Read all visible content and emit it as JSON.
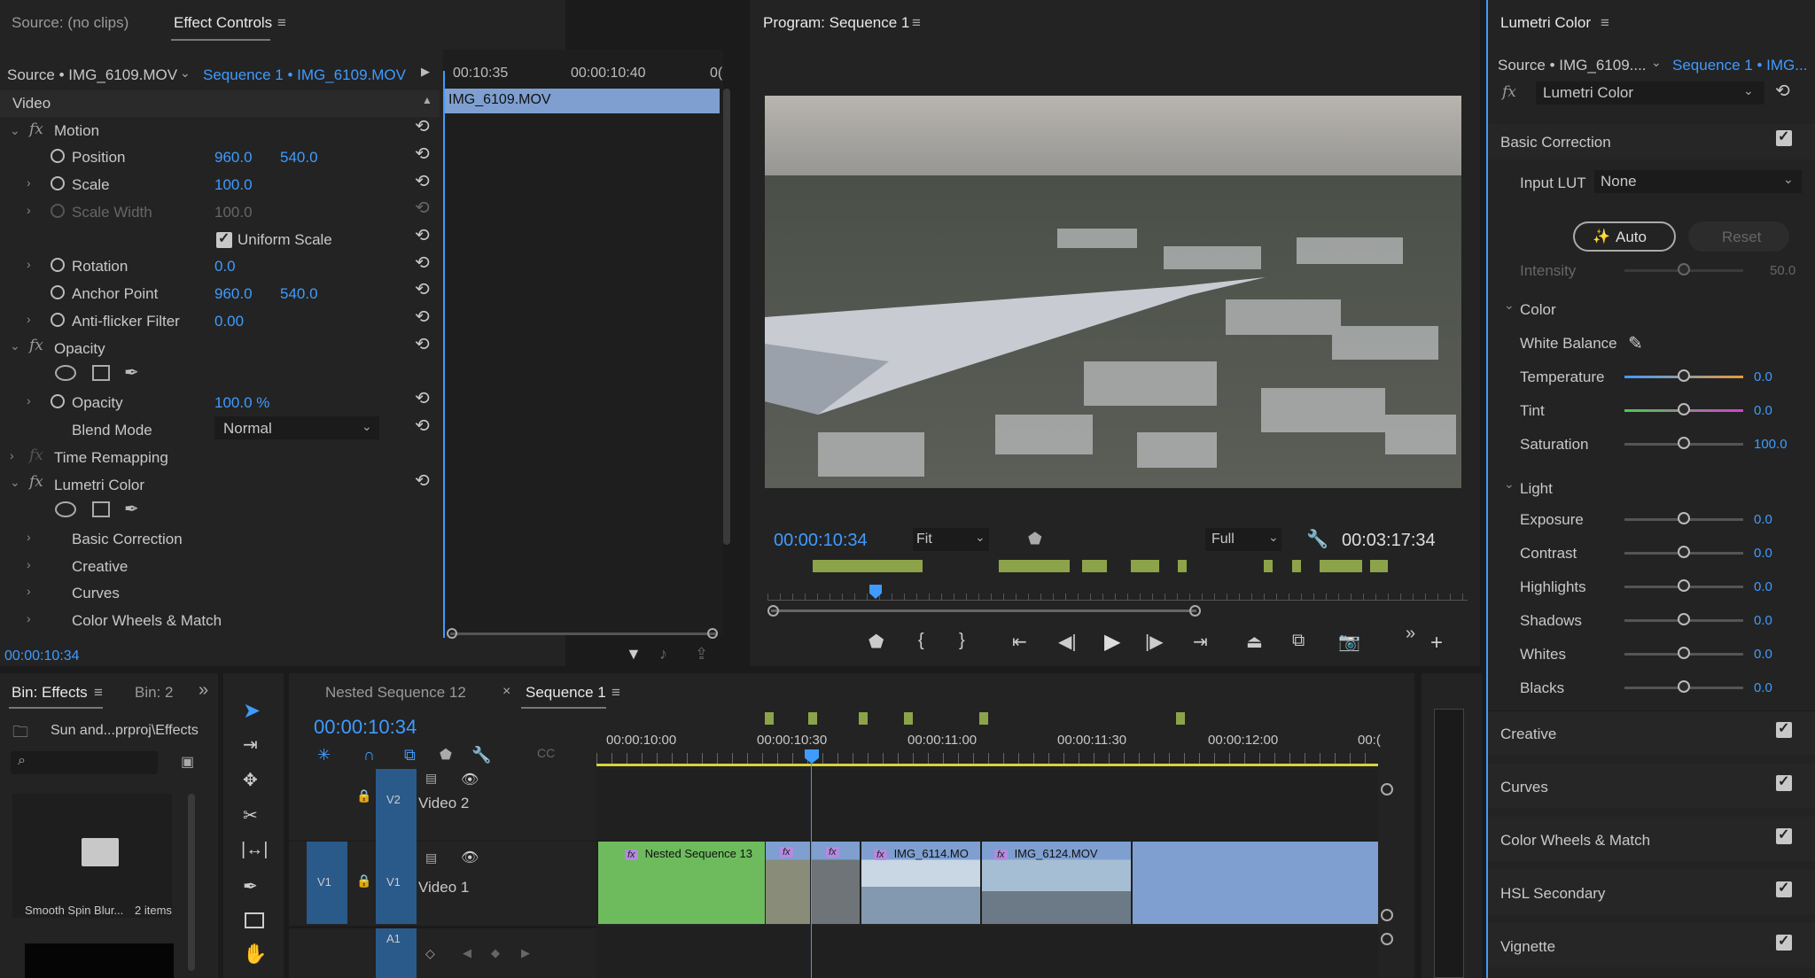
{
  "effect_controls": {
    "tabs": [
      "Source: (no clips)",
      "Effect Controls"
    ],
    "source_label": "Source • IMG_6109.MOV",
    "sequence_label": "Sequence 1 • IMG_6109.MOV",
    "time_ruler": [
      "00:10:35",
      "00:00:10:40",
      "0("
    ],
    "clip_name": "IMG_6109.MOV",
    "section_video": "Video",
    "motion": "Motion",
    "position_label": "Position",
    "position_x": "960.0",
    "position_y": "540.0",
    "scale_label": "Scale",
    "scale_val": "100.0",
    "scale_width_label": "Scale Width",
    "scale_width_val": "100.0",
    "uniform_scale": "Uniform Scale",
    "rotation_label": "Rotation",
    "rotation_val": "0.0",
    "anchor_label": "Anchor Point",
    "anchor_x": "960.0",
    "anchor_y": "540.0",
    "antiflicker_label": "Anti-flicker Filter",
    "antiflicker_val": "0.00",
    "opacity_group": "Opacity",
    "opacity_label": "Opacity",
    "opacity_val": "100.0 %",
    "blend_label": "Blend Mode",
    "blend_val": "Normal",
    "time_remap": "Time Remapping",
    "lumetri": "Lumetri Color",
    "basic": "Basic Correction",
    "creative": "Creative",
    "curves": "Curves",
    "wheels": "Color Wheels & Match",
    "timecode": "00:00:10:34"
  },
  "program": {
    "title": "Program: Sequence 1",
    "timecode": "00:00:10:34",
    "fit": "Fit",
    "quality": "Full",
    "duration": "00:03:17:34"
  },
  "lumetri": {
    "title": "Lumetri Color",
    "source": "Source • IMG_6109....",
    "sequence": "Sequence 1 • IMG...",
    "effect": "Lumetri Color",
    "basic": "Basic Correction",
    "input_lut_label": "Input LUT",
    "input_lut_val": "None",
    "auto": "Auto",
    "reset": "Reset",
    "intensity_label": "Intensity",
    "intensity_val": "50.0",
    "color": "Color",
    "wb": "White Balance",
    "temp_label": "Temperature",
    "temp_val": "0.0",
    "tint_label": "Tint",
    "tint_val": "0.0",
    "sat_label": "Saturation",
    "sat_val": "100.0",
    "light": "Light",
    "exposure_label": "Exposure",
    "exposure_val": "0.0",
    "contrast_label": "Contrast",
    "contrast_val": "0.0",
    "highlights_label": "Highlights",
    "highlights_val": "0.0",
    "shadows_label": "Shadows",
    "shadows_val": "0.0",
    "whites_label": "Whites",
    "whites_val": "0.0",
    "blacks_label": "Blacks",
    "blacks_val": "0.0",
    "sections": [
      "Creative",
      "Curves",
      "Color Wheels & Match",
      "HSL Secondary",
      "Vignette"
    ]
  },
  "bin": {
    "tab": "Bin: Effects",
    "tab2": "Bin: 2",
    "path": "Sun and...prproj\\Effects",
    "item_name": "Smooth Spin Blur...",
    "item_count": "2 items"
  },
  "timeline": {
    "tabs": [
      "Nested Sequence 12",
      "Sequence 1"
    ],
    "timecode": "00:00:10:34",
    "ruler": [
      "00:00:10:00",
      "00:00:10:30",
      "00:00:11:00",
      "00:00:11:30",
      "00:00:12:00",
      "00:("
    ],
    "v2_label": "V2",
    "v2_name": "Video 2",
    "v1_label": "V1",
    "v1_name": "Video 1",
    "v1_src": "V1",
    "a1_label": "A1",
    "clips": [
      "Nested Sequence 13",
      "IMG_6114.MO",
      "IMG_6124.MOV"
    ]
  },
  "colors": {
    "accent": "#3f9bff",
    "clip_green": "#6dbb5d",
    "clip_blue": "#7e9fd0",
    "marker": "#8da34a"
  }
}
